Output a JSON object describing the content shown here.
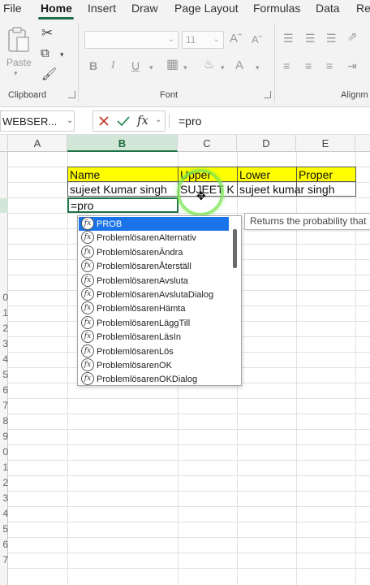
{
  "ribbon": {
    "tabs": [
      "File",
      "Home",
      "Insert",
      "Draw",
      "Page Layout",
      "Formulas",
      "Data",
      "Re"
    ],
    "active_tab": "Home",
    "groups": {
      "clipboard": "Clipboard",
      "font": "Font",
      "alignment": "Alignm"
    },
    "paste_label": "Paste",
    "font_size": "11",
    "bold": "B",
    "italic": "I",
    "underline": "U"
  },
  "formula_bar": {
    "name_box": "WEBSER...",
    "fx_label": "fx",
    "formula": "=pro"
  },
  "grid": {
    "columns": [
      "A",
      "B",
      "C",
      "D",
      "E"
    ],
    "selected_column": "B",
    "row_numbers": [
      "0",
      "1",
      "2",
      "3",
      "4",
      "5",
      "6",
      "7",
      "8",
      "9",
      "0",
      "1",
      "2",
      "3",
      "4",
      "5",
      "6",
      "7"
    ],
    "cells": {
      "B2": "Name",
      "C2": "Upper",
      "D2": "Lower",
      "E2": "Proper",
      "B3": "sujeet Kumar singh",
      "C3": "SUJEET K",
      "D3": "sujeet kumar singh",
      "B4": "=pro"
    }
  },
  "autocomplete": {
    "items": [
      "PROB",
      "ProblemlösarenAlternativ",
      "ProblemlösarenÄndra",
      "ProblemlösarenÅterställ",
      "ProblemlösarenAvsluta",
      "ProblemlösarenAvslutaDialog",
      "ProblemlösarenHämta",
      "ProblemlösarenLäggTill",
      "ProblemlösarenLäsIn",
      "ProblemlösarenLös",
      "ProblemlösarenOK",
      "ProblemlösarenOKDialog"
    ],
    "selected_index": 0,
    "tooltip": "Returns the probability that"
  },
  "colors": {
    "accent": "#1e7145",
    "header_fill": "#ffff00",
    "selection_blue": "#1a73e8"
  },
  "icons": [
    "cut-icon",
    "copy-icon",
    "format-painter-icon",
    "paste-icon",
    "cancel-icon",
    "enter-icon",
    "function-icon"
  ]
}
